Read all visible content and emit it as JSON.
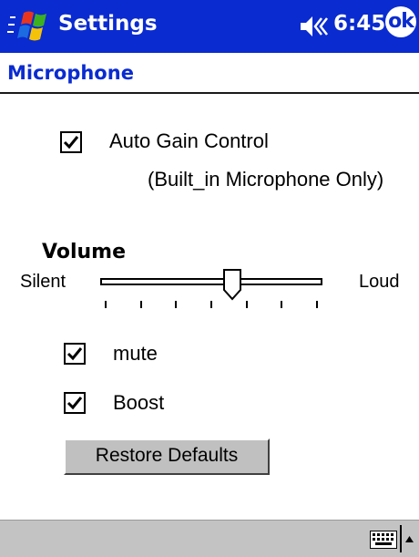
{
  "titlebar": {
    "title": "Settings",
    "time": "6:45",
    "ok_label": "ok"
  },
  "page": {
    "header": "Microphone"
  },
  "auto_gain": {
    "label": "Auto Gain Control",
    "sublabel": "(Built_in Microphone Only)",
    "checked": true
  },
  "volume": {
    "label": "Volume",
    "min_label": "Silent",
    "max_label": "Loud",
    "level_fraction": 0.6,
    "tick_count": 7
  },
  "mute": {
    "label": "mute",
    "checked": true
  },
  "boost": {
    "label": "Boost",
    "checked": true
  },
  "restore_button": {
    "label": "Restore Defaults"
  },
  "colors": {
    "titlebar": "#0a2bd0",
    "header_text": "#0a2bd0",
    "bottombar": "#c3c3c3"
  },
  "icons": [
    "windows-start-icon",
    "speaker-icon",
    "ok-icon",
    "checkbox-check-icon",
    "keyboard-icon",
    "sip-arrow-icon"
  ]
}
